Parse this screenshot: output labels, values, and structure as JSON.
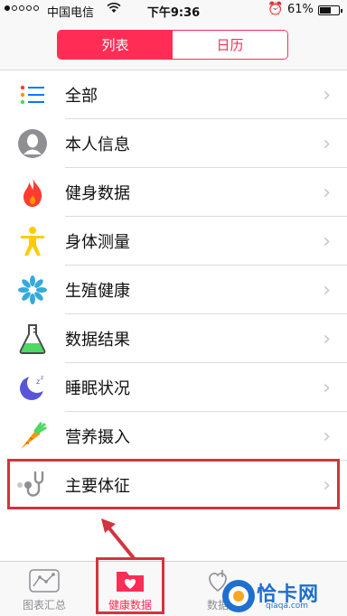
{
  "status_bar": {
    "carrier": "中国电信",
    "time": "下午9:36",
    "battery": "61%"
  },
  "segments": [
    {
      "label": "列表",
      "active": true
    },
    {
      "label": "日历",
      "active": false
    }
  ],
  "list_items": [
    {
      "label": "全部",
      "icon": "list-icon"
    },
    {
      "label": "本人信息",
      "icon": "person-icon"
    },
    {
      "label": "健身数据",
      "icon": "flame-icon"
    },
    {
      "label": "身体测量",
      "icon": "body-figure-icon"
    },
    {
      "label": "生殖健康",
      "icon": "flower-icon"
    },
    {
      "label": "数据结果",
      "icon": "flask-icon"
    },
    {
      "label": "睡眠状况",
      "icon": "moon-icon"
    },
    {
      "label": "营养摄入",
      "icon": "carrot-icon"
    },
    {
      "label": "主要体征",
      "icon": "stethoscope-icon",
      "highlighted": true
    }
  ],
  "tabs": [
    {
      "label": "图表汇总",
      "icon": "chart-icon",
      "active": false
    },
    {
      "label": "健康数据",
      "icon": "health-folder-icon",
      "active": true
    },
    {
      "label": "数据",
      "icon": "heart-data-icon",
      "active": false
    }
  ],
  "watermark": {
    "text": "恰卡网",
    "url": "qiaqa.com"
  },
  "colors": {
    "accent": "#ff2d55",
    "annotation_red": "#d2343f"
  }
}
